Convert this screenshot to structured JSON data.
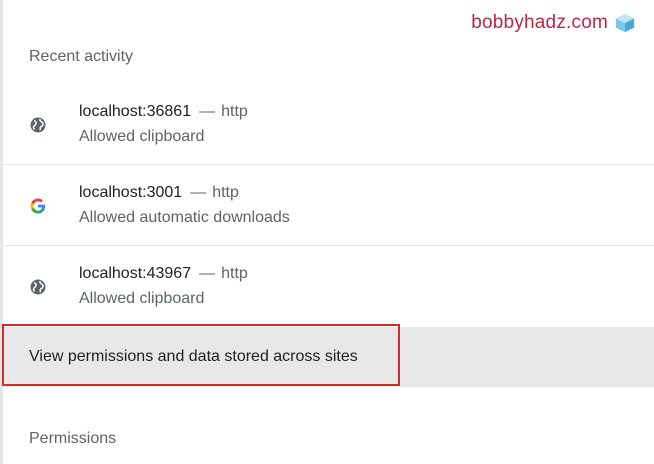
{
  "watermark": {
    "text": "bobbyhadz.com",
    "icon": "cube-icon"
  },
  "recent_activity": {
    "title": "Recent activity",
    "items": [
      {
        "host": "localhost:36861",
        "separator": "—",
        "protocol": "http",
        "action": "Allowed clipboard",
        "icon": "globe-icon"
      },
      {
        "host": "localhost:3001",
        "separator": "—",
        "protocol": "http",
        "action": "Allowed automatic downloads",
        "icon": "google-icon"
      },
      {
        "host": "localhost:43967",
        "separator": "—",
        "protocol": "http",
        "action": "Allowed clipboard",
        "icon": "globe-icon"
      }
    ]
  },
  "view_permissions": {
    "label": "View permissions and data stored across sites"
  },
  "permissions": {
    "title": "Permissions"
  },
  "colors": {
    "watermark": "#b72a45",
    "highlight": "#d22b2b",
    "row_hover": "#e8e8e8"
  }
}
